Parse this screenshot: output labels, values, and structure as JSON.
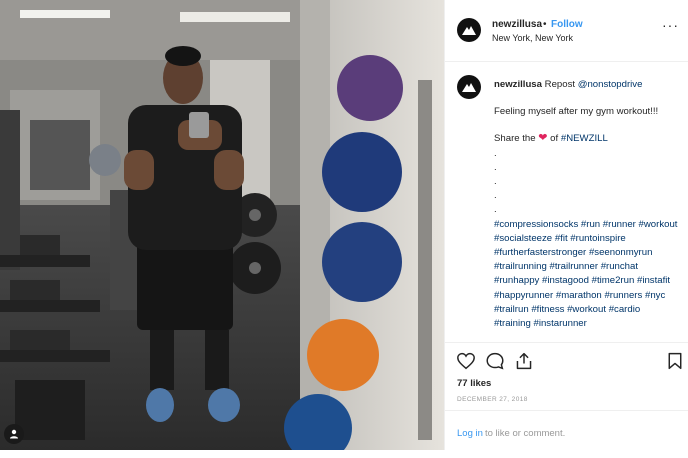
{
  "post": {
    "username": "newzillusa",
    "separator": "•",
    "follow_label": "Follow",
    "location": "New York, New York",
    "more_icon": "more-options-icon"
  },
  "caption": {
    "username": "newzillusa",
    "repost_prefix": "Repost",
    "repost_handle": "@nonstopdrive",
    "line1": "Feeling myself after my gym workout!!!",
    "share_prefix": "Share the",
    "share_of": "of",
    "share_tag": "#NEWZILL",
    "dots": [
      ".",
      ".",
      ".",
      ".",
      "."
    ],
    "hashtags": [
      "#compressionsocks",
      "#run",
      "#runner",
      "#workout",
      "#socialsteeze",
      "#fit",
      "#runtoinspire",
      "#furtherfasterstronger",
      "#seenonmyrun",
      "#trailrunning",
      "#trailrunner",
      "#runchat",
      "#runhappy",
      "#instagood",
      "#time2run",
      "#instafit",
      "#happyrunner",
      "#marathon",
      "#runners",
      "#nyc",
      "#trailrun",
      "#fitness",
      "#workout",
      "#cardio",
      "#training",
      "#instarunner"
    ]
  },
  "stats": {
    "likes": "77 likes",
    "date": "DECEMBER 27, 2018"
  },
  "login": {
    "link": "Log in",
    "rest": "to like or comment."
  },
  "colors": {
    "follow": "#3897f0",
    "link": "#003569",
    "heart": "#e0245e",
    "divider": "#efefef"
  }
}
